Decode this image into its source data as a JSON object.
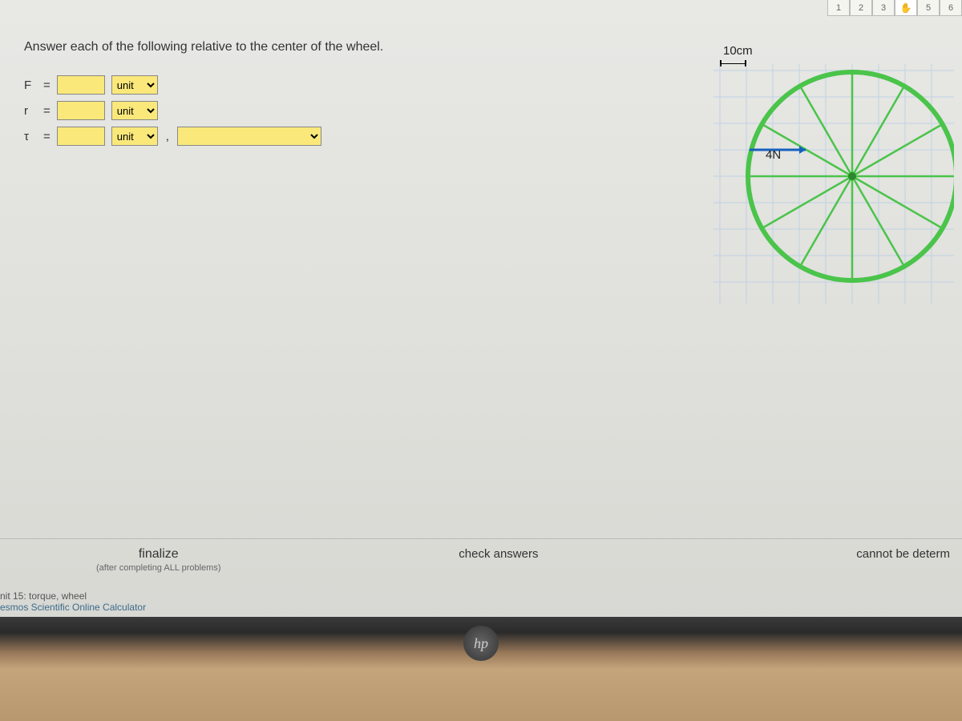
{
  "tabs": [
    "1",
    "2",
    "3",
    "✋",
    "5",
    "6"
  ],
  "prompt": "Answer each of the following relative to the center of the wheel.",
  "rows": [
    {
      "var": "F",
      "equals": "=",
      "unit_label": "unit"
    },
    {
      "var": "r",
      "equals": "=",
      "unit_label": "unit"
    },
    {
      "var": "τ",
      "equals": "=",
      "unit_label": "unit"
    }
  ],
  "comma": ",",
  "diagram": {
    "scale": "10cm",
    "force": "4N"
  },
  "bottom": {
    "finalize": "finalize",
    "finalize_sub": "(after completing ALL problems)",
    "check": "check answers",
    "cannot": "cannot be determ"
  },
  "footer": {
    "line1": "nit 15: torque, wheel",
    "line2": "esmos Scientific Online Calculator"
  },
  "logo": "hp"
}
